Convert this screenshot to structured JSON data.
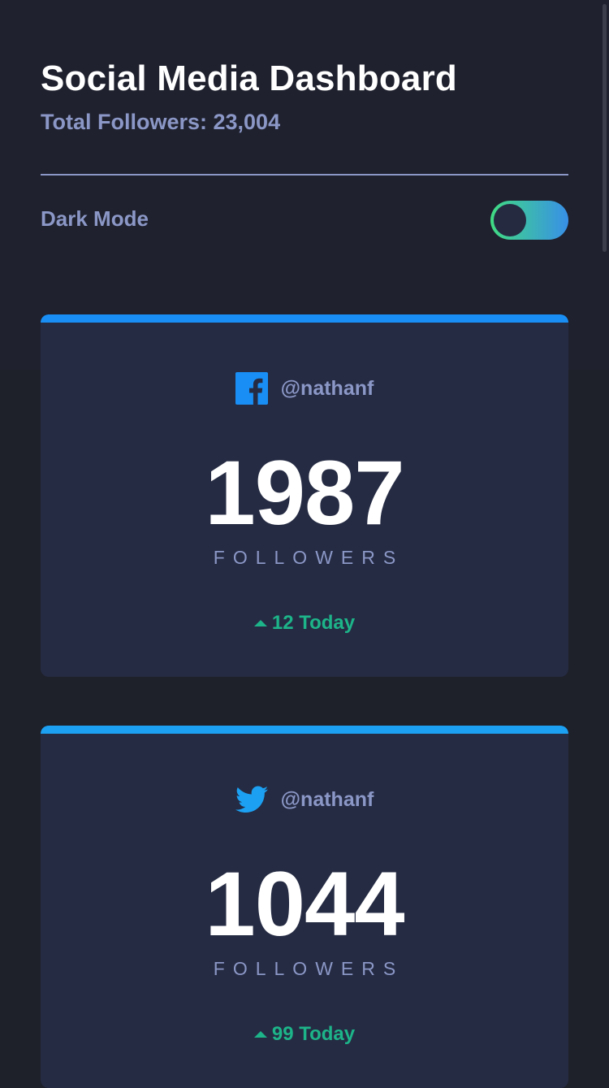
{
  "header": {
    "title": "Social Media Dashboard",
    "total_followers": "Total Followers: 23,004"
  },
  "mode": {
    "label": "Dark Mode",
    "dark_enabled": true
  },
  "colors": {
    "facebook": "#198ff5",
    "twitter": "#1ca0f2",
    "positive": "#1db489"
  },
  "cards": [
    {
      "platform": "facebook",
      "icon": "facebook-icon",
      "handle": "@nathanf",
      "count": "1987",
      "label": "FOLLOWERS",
      "today": "12 Today"
    },
    {
      "platform": "twitter",
      "icon": "twitter-icon",
      "handle": "@nathanf",
      "count": "1044",
      "label": "FOLLOWERS",
      "today": "99 Today"
    }
  ]
}
